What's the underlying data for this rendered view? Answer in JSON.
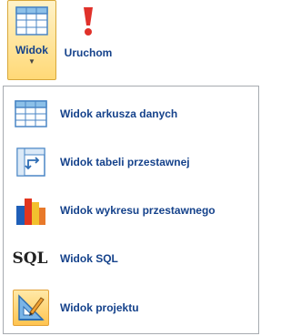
{
  "ribbon": {
    "view_button": {
      "label": "Widok",
      "icon": "datasheet-grid-icon"
    },
    "run_button": {
      "label": "Uruchom",
      "icon": "exclamation-icon"
    }
  },
  "menu": {
    "items": [
      {
        "label": "Widok arkusza danych",
        "icon": "datasheet-icon"
      },
      {
        "label": "Widok tabeli przestawnej",
        "icon": "pivot-table-icon"
      },
      {
        "label": "Widok wykresu przestawnego",
        "icon": "pivot-chart-icon"
      },
      {
        "label": "Widok SQL",
        "icon": "sql-icon",
        "icon_text": "SQL"
      },
      {
        "label": "Widok projektu",
        "icon": "design-view-icon",
        "selected": true
      }
    ]
  },
  "colors": {
    "label": "#15428b",
    "highlight_top": "#fff2c8",
    "highlight_bottom": "#ffd977",
    "run_icon": "#e0312a"
  }
}
